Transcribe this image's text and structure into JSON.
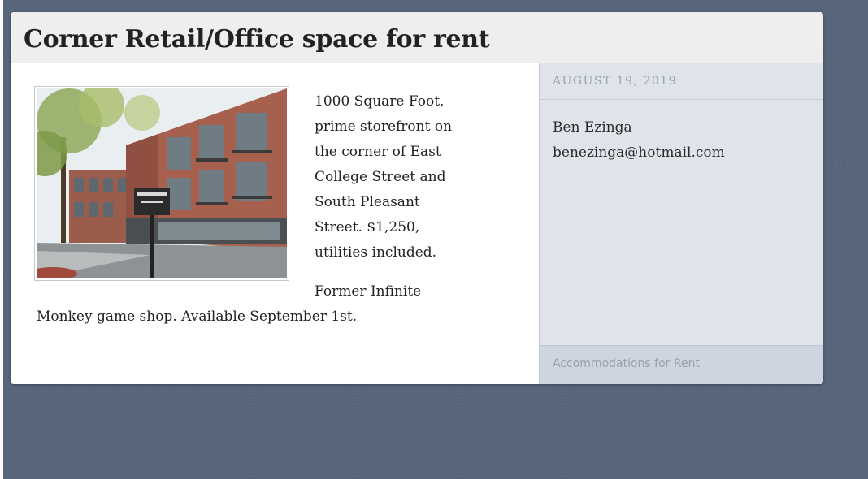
{
  "post": {
    "title": "Corner Retail/Office space for rent",
    "description_lines": [
      "1000 Square Foot,",
      "prime storefront on",
      "the corner of East",
      "College Street and",
      "South Pleasant",
      "Street. $1,250,",
      "utilities included."
    ],
    "description_2": "Former Infinite Monkey game shop. Available September 1st.",
    "photo_alt": "Downtown storefront building with sign"
  },
  "sidebar": {
    "date": "AUGUST 19, 2019",
    "contact_name": "Ben Ezinga",
    "contact_email": "benezinga@hotmail.com",
    "category": "Accommodations for Rent"
  },
  "colors": {
    "background": "#56657a",
    "card": "#ffffff",
    "header": "#eeeeee",
    "sidebar": "#dfe3ea",
    "sidebar_footer": "#cfd5de"
  }
}
